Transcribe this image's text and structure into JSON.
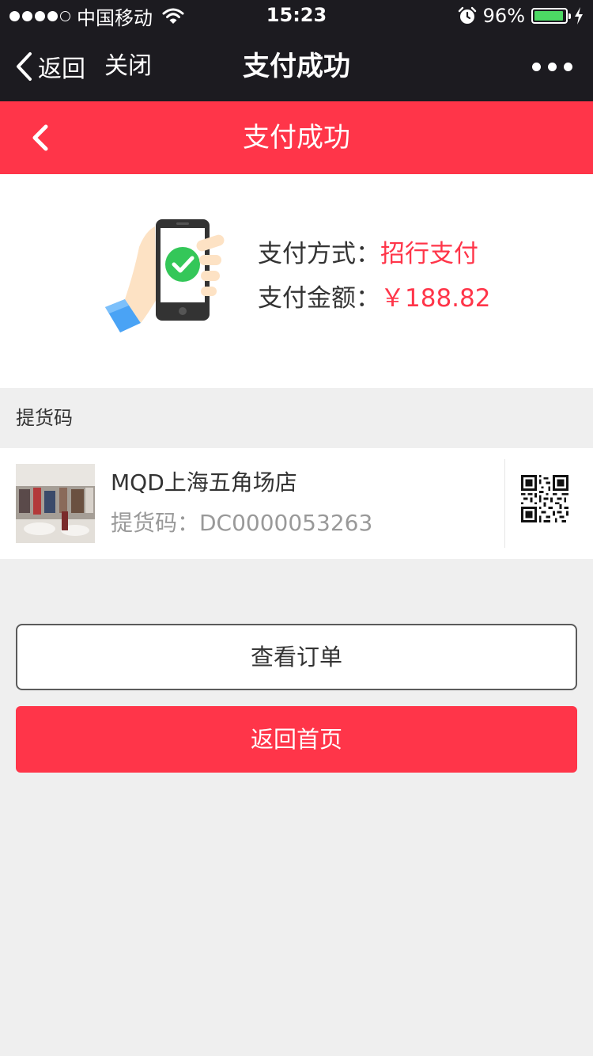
{
  "status_bar": {
    "carrier": "中国移动",
    "time": "15:23",
    "battery_percent": "96%",
    "battery_level": 0.96,
    "icons": [
      "signal-dots",
      "wifi-icon",
      "alarm-icon",
      "battery-icon",
      "charging-bolt-icon"
    ]
  },
  "wx_nav": {
    "back_label": "返回",
    "close_label": "关闭",
    "title": "支付成功",
    "more_icon": "more-dots-icon"
  },
  "app_header": {
    "title": "支付成功",
    "back_icon": "chevron-left-icon"
  },
  "payment": {
    "method_label": "支付方式：",
    "method_value": "招行支付",
    "amount_label": "支付金额：",
    "amount_value": "￥188.82",
    "illustration": "phone-check-illustration"
  },
  "pickup": {
    "section_label": "提货码",
    "store_name": "MQD上海五角场店",
    "code_text": "提货码：DC0000053263",
    "qr_icon": "qr-code-icon"
  },
  "buttons": {
    "view_order": "查看订单",
    "back_home": "返回首页"
  },
  "colors": {
    "accent": "#ff3549",
    "nav_bg": "#1c1b20",
    "page_bg": "#efefef",
    "success_green": "#34c759",
    "battery_green": "#4cd964"
  }
}
